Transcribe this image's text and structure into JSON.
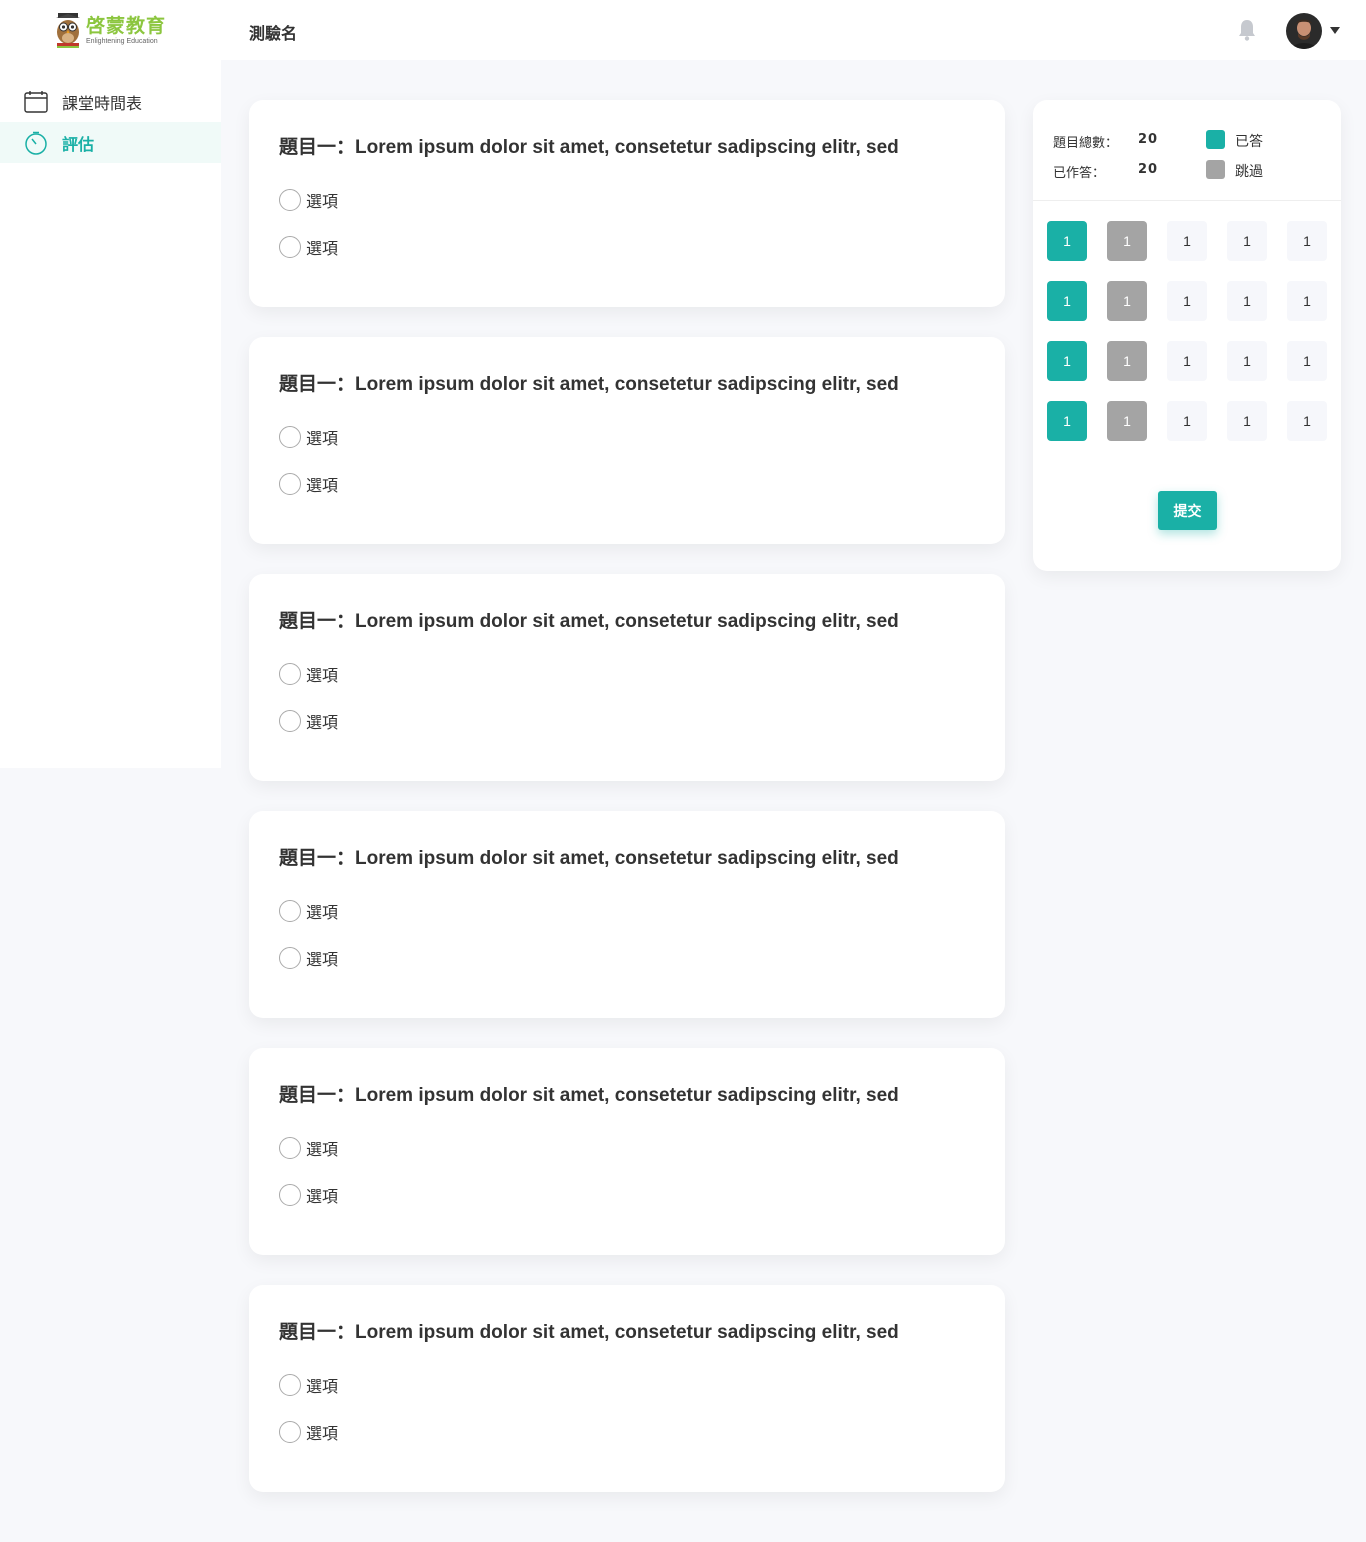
{
  "brand": {
    "name": "啓蒙教育",
    "tagline": "Enlightening Education"
  },
  "sidebar": {
    "items": [
      {
        "label": "課堂時間表",
        "icon": "calendar-icon",
        "active": false
      },
      {
        "label": "評估",
        "icon": "stopwatch-icon",
        "active": true
      }
    ]
  },
  "header": {
    "title": "測驗名"
  },
  "questions": [
    {
      "title": "題目一：Lorem ipsum dolor sit amet, consetetur sadipscing elitr, sed",
      "options": [
        "選項",
        "選項"
      ]
    },
    {
      "title": "題目一：Lorem ipsum dolor sit amet, consetetur sadipscing elitr, sed",
      "options": [
        "選項",
        "選項"
      ]
    },
    {
      "title": "題目一：Lorem ipsum dolor sit amet, consetetur sadipscing elitr, sed",
      "options": [
        "選項",
        "選項"
      ]
    },
    {
      "title": "題目一：Lorem ipsum dolor sit amet, consetetur sadipscing elitr, sed",
      "options": [
        "選項",
        "選項"
      ]
    },
    {
      "title": "題目一：Lorem ipsum dolor sit amet, consetetur sadipscing elitr, sed",
      "options": [
        "選項",
        "選項"
      ]
    },
    {
      "title": "題目一：Lorem ipsum dolor sit amet, consetetur sadipscing elitr, sed",
      "options": [
        "選項",
        "選項"
      ]
    }
  ],
  "panel": {
    "total_label": "題目總數：",
    "total_value": "20",
    "answered_label": "已作答：",
    "answered_value": "20",
    "legend_answered": "已答",
    "legend_skipped": "跳過",
    "grid": [
      [
        {
          "label": "1",
          "state": "answered"
        },
        {
          "label": "1",
          "state": "skipped"
        },
        {
          "label": "1",
          "state": "pending"
        },
        {
          "label": "1",
          "state": "pending"
        },
        {
          "label": "1",
          "state": "pending"
        }
      ],
      [
        {
          "label": "1",
          "state": "answered"
        },
        {
          "label": "1",
          "state": "skipped"
        },
        {
          "label": "1",
          "state": "pending"
        },
        {
          "label": "1",
          "state": "pending"
        },
        {
          "label": "1",
          "state": "pending"
        }
      ],
      [
        {
          "label": "1",
          "state": "answered"
        },
        {
          "label": "1",
          "state": "skipped"
        },
        {
          "label": "1",
          "state": "pending"
        },
        {
          "label": "1",
          "state": "pending"
        },
        {
          "label": "1",
          "state": "pending"
        }
      ],
      [
        {
          "label": "1",
          "state": "answered"
        },
        {
          "label": "1",
          "state": "skipped"
        },
        {
          "label": "1",
          "state": "pending"
        },
        {
          "label": "1",
          "state": "pending"
        },
        {
          "label": "1",
          "state": "pending"
        }
      ]
    ],
    "submit_label": "提交"
  },
  "colors": {
    "accent": "#1ab0a6",
    "skipped": "#a4a4a4",
    "pending": "#f6f7fb",
    "brand_green": "#8cc63f"
  }
}
